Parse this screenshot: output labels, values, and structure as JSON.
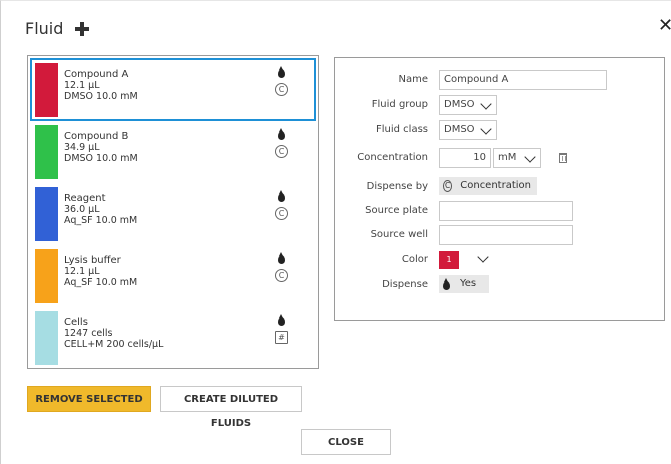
{
  "dialog": {
    "title": "Fluid"
  },
  "fluids": [
    {
      "name": "Compound A",
      "volume": "12.1 µL",
      "detail": "DMSO  10.0 mM",
      "color": "#d21a3b",
      "mode": "C",
      "selected": true
    },
    {
      "name": "Compound B",
      "volume": "34.9 µL",
      "detail": "DMSO  10.0 mM",
      "color": "#2fc14a",
      "mode": "C",
      "selected": false
    },
    {
      "name": "Reagent",
      "volume": "36.0 µL",
      "detail": "Aq_SF  10.0 mM",
      "color": "#3161d6",
      "mode": "C",
      "selected": false
    },
    {
      "name": "Lysis buffer",
      "volume": "12.1 µL",
      "detail": "Aq_SF  10.0 mM",
      "color": "#f7a21a",
      "mode": "C",
      "selected": false
    },
    {
      "name": "Cells",
      "volume": "1247 cells",
      "detail": "CELL+M  200 cells/µL",
      "color": "#a6dde3",
      "mode": "#",
      "selected": false
    }
  ],
  "properties": {
    "name_label": "Name",
    "name_value": "Compound A",
    "fluid_group_label": "Fluid group",
    "fluid_group_value": "DMSO",
    "fluid_class_label": "Fluid class",
    "fluid_class_value": "DMSO",
    "concentration_label": "Concentration",
    "concentration_value": "10",
    "concentration_unit": "mM",
    "dispense_by_label": "Dispense by",
    "dispense_by_icon": "C",
    "dispense_by_value": "Concentration",
    "source_plate_label": "Source plate",
    "source_plate_value": "",
    "source_well_label": "Source well",
    "source_well_value": "",
    "color_label": "Color",
    "color_value": "1",
    "dispense_label": "Dispense",
    "dispense_value": "Yes"
  },
  "buttons": {
    "remove_selected": "REMOVE SELECTED",
    "create_diluted": "CREATE DILUTED FLUIDS",
    "close": "CLOSE"
  }
}
